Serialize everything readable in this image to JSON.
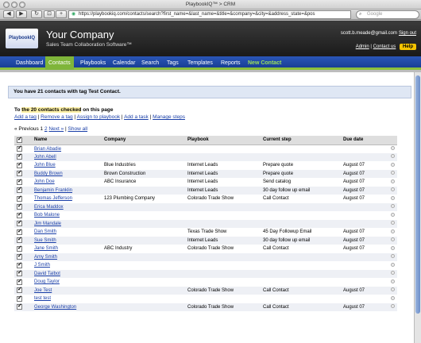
{
  "browser": {
    "title": "PlaybookIQ™ > CRM",
    "url": "https://playbookiq.com/contacts/search?first_name=&last_name=&title=&company=&city=&address_state=&pos",
    "search_placeholder": "Google"
  },
  "header": {
    "logo_text": "PlaybookIQ",
    "company": "Your Company",
    "tagline": "Sales Team Collaboration Software™",
    "user_email": "scott.b.meade@gmail.com",
    "signout": "Sign out",
    "admin": "Admin",
    "contact_us": "Contact us",
    "help": "Help"
  },
  "nav": {
    "items": [
      "Dashboard",
      "Contacts",
      "Playbooks",
      "Calendar",
      "Search",
      "Tags",
      "Templates",
      "Reports",
      "New Contact"
    ],
    "active": "Contacts"
  },
  "main": {
    "notice": "You have 21 contacts with tag Test Contact.",
    "selection_prefix": "To ",
    "selection_highlight": "the 20 contacts checked",
    "selection_suffix": " on this page",
    "actions": [
      "Add a tag",
      "Remove a tag",
      "Assign to playbook",
      "Add a task",
      "Manage steps"
    ],
    "pager": {
      "previous": "« Previous",
      "page1": "1",
      "page2": "2",
      "next": "Next »",
      "show_all": "Show all"
    },
    "table": {
      "columns": [
        "Name",
        "Company",
        "Playbook",
        "Current step",
        "Due date"
      ],
      "rows": [
        {
          "name": "Brian Abadie",
          "company": "",
          "playbook": "",
          "step": "",
          "due": ""
        },
        {
          "name": "John Abell",
          "company": "",
          "playbook": "",
          "step": "",
          "due": ""
        },
        {
          "name": "John Blue",
          "company": "Blue Industries",
          "playbook": "Internet Leads",
          "step": "Prepare quote",
          "due": "August 07"
        },
        {
          "name": "Buddy Brown",
          "company": "Brown Construction",
          "playbook": "Internet Leads",
          "step": "Prepare quote",
          "due": "August 07"
        },
        {
          "name": "John Doe",
          "company": "ABC Insurance",
          "playbook": "Internet Leads",
          "step": "Send catalog",
          "due": "August 07"
        },
        {
          "name": "Benjamin Franklin",
          "company": "",
          "playbook": "Internet Leads",
          "step": "30 day follow up email",
          "due": "August 07"
        },
        {
          "name": "Thomas Jefferson",
          "company": "123 Plumbing Company",
          "playbook": "Colorado Trade Show",
          "step": "Call Contact",
          "due": "August 07"
        },
        {
          "name": "Erica Maddox",
          "company": "",
          "playbook": "",
          "step": "",
          "due": ""
        },
        {
          "name": "Bob Malone",
          "company": "",
          "playbook": "",
          "step": "",
          "due": ""
        },
        {
          "name": "Jim Mandale",
          "company": "",
          "playbook": "",
          "step": "",
          "due": ""
        },
        {
          "name": "Dan Smith",
          "company": "",
          "playbook": "Texas Trade Show",
          "step": "45 Day Followup Email",
          "due": "August 07"
        },
        {
          "name": "Sue Smith",
          "company": "",
          "playbook": "Internet Leads",
          "step": "30 day follow up email",
          "due": "August 07"
        },
        {
          "name": "Jane Smith",
          "company": "ABC Industry",
          "playbook": "Colorado Trade Show",
          "step": "Call Contact",
          "due": "August 07"
        },
        {
          "name": "Amy Smith",
          "company": "",
          "playbook": "",
          "step": "",
          "due": ""
        },
        {
          "name": "J Smith",
          "company": "",
          "playbook": "",
          "step": "",
          "due": ""
        },
        {
          "name": "David Talbot",
          "company": "",
          "playbook": "",
          "step": "",
          "due": ""
        },
        {
          "name": "Doug Taylor",
          "company": "",
          "playbook": "",
          "step": "",
          "due": ""
        },
        {
          "name": "Joe Test",
          "company": "",
          "playbook": "Colorado Trade Show",
          "step": "Call Contact",
          "due": "August 07"
        },
        {
          "name": "test test",
          "company": "",
          "playbook": "",
          "step": "",
          "due": ""
        },
        {
          "name": "George Washington",
          "company": "",
          "playbook": "Colorado Trade Show",
          "step": "Call Contact",
          "due": "August 07"
        }
      ]
    }
  },
  "colors": {
    "nav_blue": "#1f4ba8",
    "nav_active_green": "#7fb53a",
    "link_blue": "#1a3fa8",
    "help_yellow": "#f5c400"
  }
}
